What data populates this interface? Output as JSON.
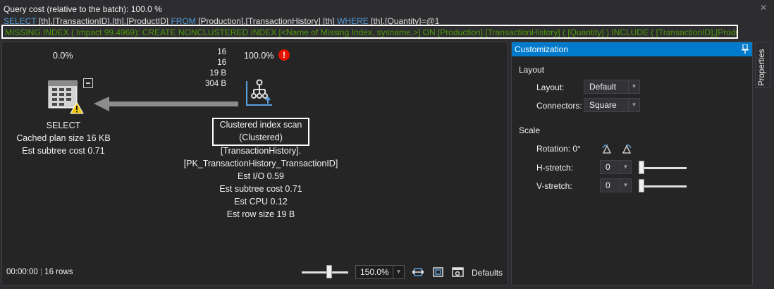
{
  "header": {
    "query_cost": "Query cost (relative to the batch):  100.0 %",
    "sql": {
      "select_kw": "SELECT",
      "columns": "[th].[TransactionID],[th].[ProductID]",
      "from_kw": "FROM",
      "table": "[Production].[TransactionHistory] [th]",
      "where_kw": "WHERE",
      "condition": "[th].[Quantity]=@1"
    },
    "missing_index": "MISSING INDEX ( Impact 99.4969): CREATE NONCLUSTERED INDEX [<Name of Missing Index, sysname,>] ON [Production].[TransactionHistory]  ( [Quantity] ) INCLUDE ( [TransactionID],[ProductID] )"
  },
  "plan": {
    "select_node": {
      "cost_pct": "0.0%",
      "name": "SELECT",
      "cached_plan_size": "Cached plan size  16 KB",
      "est_subtree_cost": "Est subtree cost  0.71"
    },
    "edge_stats": [
      "16",
      "16",
      "19 B",
      "304 B"
    ],
    "scan_node": {
      "cost_pct": "100.0%",
      "warning_glyph": "!",
      "name_line1": "Clustered index scan",
      "name_line2": "(Clustered)",
      "object_line1": "[TransactionHistory].",
      "object_line2": "[PK_TransactionHistory_TransactionID]",
      "est_io": "Est I/O  0.59",
      "est_subtree_cost": "Est subtree cost  0.71",
      "est_cpu": "Est CPU  0.12",
      "est_row_size": "Est row size  19 B"
    }
  },
  "status_bar": {
    "elapsed": "00:00:00",
    "separator": "|",
    "rows": "16 rows",
    "zoom": "150.0%",
    "zoom_level_fraction": 0.6,
    "defaults_label": "Defaults"
  },
  "customization": {
    "title": "Customization",
    "layout_section": "Layout",
    "layout_label": "Layout:",
    "layout_value": "Default",
    "connectors_label": "Connectors:",
    "connectors_value": "Square",
    "scale_section": "Scale",
    "rotation_label": "Rotation: 0°",
    "hstretch_label": "H-stretch:",
    "hstretch_value": "0",
    "vstretch_label": "V-stretch:",
    "vstretch_value": "0"
  },
  "side_tab": {
    "label": "Properties"
  },
  "colors": {
    "background": "#2d2d30",
    "panel": "#252526",
    "accent": "#007acc",
    "sql_keyword": "#569cd6",
    "missing_index_text": "#4e9a06",
    "error_red": "#e51400",
    "warning_yellow": "#f2c80f"
  }
}
